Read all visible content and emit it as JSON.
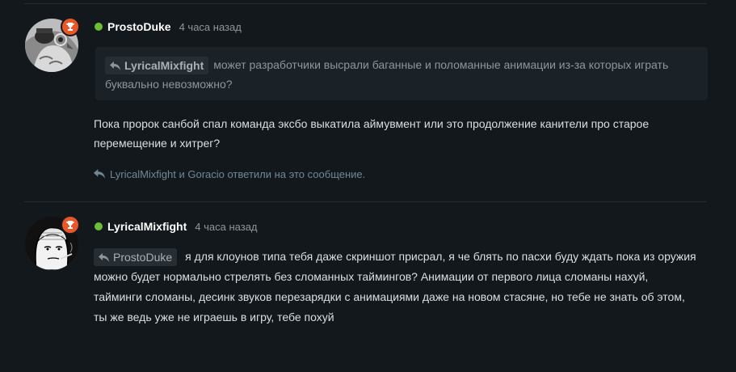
{
  "colors": {
    "background": "#13181c",
    "online": "#6abf36",
    "badge": "#e8572a",
    "reply_text": "#6f8894"
  },
  "posts": [
    {
      "username": "ProstoDuke",
      "time": "4 часа назад",
      "avatar_icon": "owl-with-glasses-avatar",
      "badge_icon": "trophy-icon",
      "quote": {
        "author": "LyricalMixfight",
        "text": "может разработчики высрали баганные и поломанные анимации из-за которых играть буквально невозможно?"
      },
      "text": "Пока пророк санбой спал команда эксбо выкатила аймувмент или это продолжение канители про старое перемещение и хитрег?",
      "replies": {
        "text": "LyricalMixfight и Goracio ответили на это сообщение."
      }
    },
    {
      "username": "LyricalMixfight",
      "time": "4 часа назад",
      "avatar_icon": "wojak-smoking-avatar",
      "badge_icon": "trophy-icon",
      "mention": "ProstoDuke",
      "text": "я для клоунов типа тебя даже скриншот присрал, я че блять по пасхи буду ждать пока из оружия можно будет нормально стрелять без сломанных таймингов? Анимации от первого лица сломаны нахуй, тайминги сломаны, десинк звуков перезарядки с анимациями даже на новом стасяне, но тебе не знать об этом, ты же ведь уже не играешь в игру, тебе похуй"
    }
  ]
}
